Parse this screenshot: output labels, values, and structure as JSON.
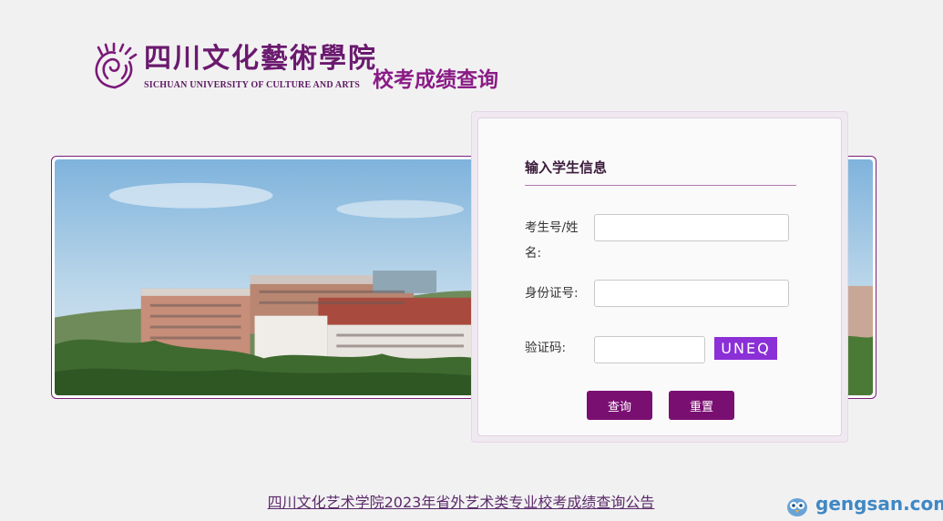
{
  "header": {
    "logo_cn": "四川文化藝術學院",
    "logo_en": "SICHUAN UNIVERSITY OF CULTURE AND ARTS",
    "title": "校考成绩查询"
  },
  "banner": {
    "icon": "campus-photo"
  },
  "form": {
    "title": "输入学生信息",
    "exam_label": "考生号/姓名:",
    "exam_value": "",
    "id_label": "身份证号:",
    "id_value": "",
    "code_label": "验证码:",
    "code_value": "",
    "captcha_text": "UNEQ",
    "query_button": "查询",
    "reset_button": "重置"
  },
  "notice": {
    "link_text": "四川文化艺术学院2023年省外艺术类专业校考成绩查询公告"
  },
  "watermark": {
    "text": "gengsan.com",
    "icon": "owl-icon"
  },
  "colors": {
    "brand_purple": "#7a0f72",
    "title_purple": "#8a1c86",
    "captcha_bg": "#8b2fd6",
    "watermark_blue": "#3f88c5"
  }
}
